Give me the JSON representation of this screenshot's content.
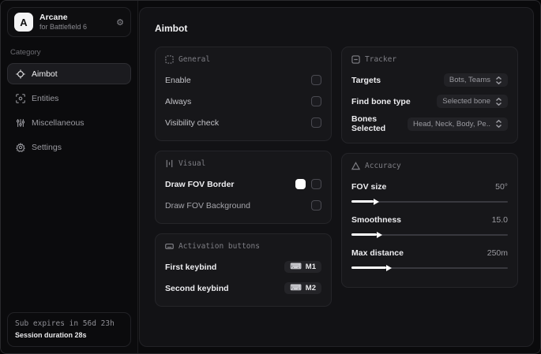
{
  "app": {
    "logo_letter": "A",
    "name": "Arcane",
    "subtitle": "for Battlefield 6"
  },
  "sidebar": {
    "category_label": "Category",
    "items": [
      {
        "label": "Aimbot",
        "selected": true
      },
      {
        "label": "Entities",
        "selected": false
      },
      {
        "label": "Miscellaneous",
        "selected": false
      },
      {
        "label": "Settings",
        "selected": false
      }
    ],
    "footer": {
      "expiry": "Sub expires in 56d 23h",
      "session": "Session duration 28s"
    }
  },
  "page": {
    "title": "Aimbot"
  },
  "sections": {
    "general": {
      "title": "General",
      "rows": [
        {
          "label": "Enable",
          "checked": false
        },
        {
          "label": "Always",
          "checked": false
        },
        {
          "label": "Visibility check",
          "checked": false
        }
      ]
    },
    "visual": {
      "title": "Visual",
      "rows": [
        {
          "label": "Draw FOV Border",
          "swatch_color": "#ffffff",
          "checked": false
        },
        {
          "label": "Draw FOV Background",
          "checked": false
        }
      ]
    },
    "activation": {
      "title": "Activation buttons",
      "rows": [
        {
          "label": "First keybind",
          "key": "M1"
        },
        {
          "label": "Second keybind",
          "key": "M2"
        }
      ]
    },
    "tracker": {
      "title": "Tracker",
      "rows": [
        {
          "label": "Targets",
          "value": "Bots, Teams"
        },
        {
          "label": "Find bone type",
          "value": "Selected bone"
        },
        {
          "label": "Bones Selected",
          "value": "Head, Neck, Body, Pe.."
        }
      ]
    },
    "accuracy": {
      "title": "Accuracy",
      "rows": [
        {
          "label": "FOV size",
          "value": "50°",
          "fill_percent": 14
        },
        {
          "label": "Smoothness",
          "value": "15.0",
          "fill_percent": 16
        },
        {
          "label": "Max distance",
          "value": "250m",
          "fill_percent": 22
        }
      ]
    }
  }
}
